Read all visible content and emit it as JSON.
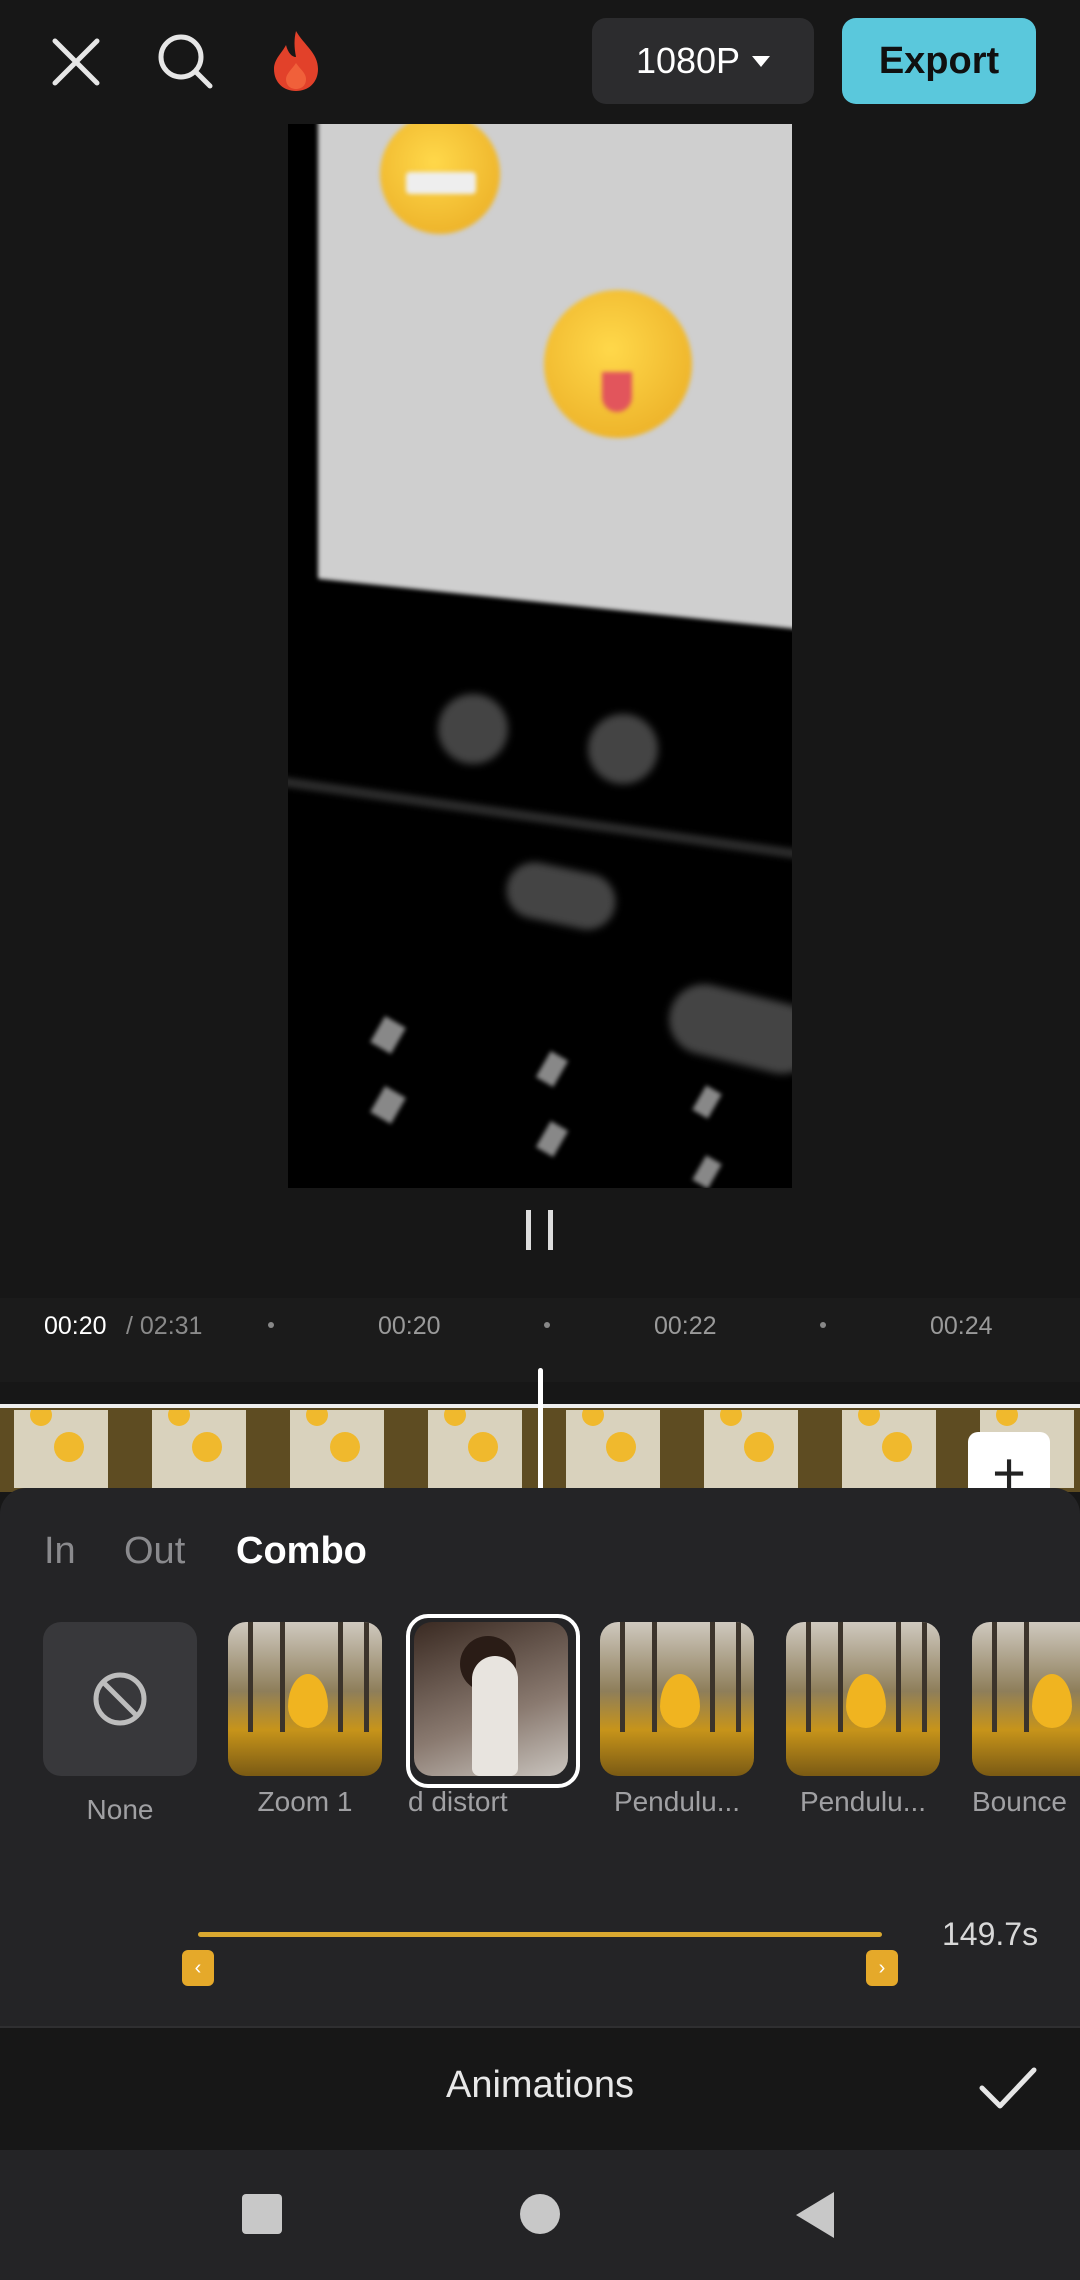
{
  "header": {
    "close_icon": "close-icon",
    "search_icon": "search-icon",
    "flame_icon": "flame-icon",
    "resolution_label": "1080P",
    "export_label": "Export",
    "export_color": "#5ac8dc"
  },
  "player": {
    "pause_icon": "pause-icon",
    "current_time": "00:20",
    "total_time": "/ 02:31"
  },
  "timeline": {
    "ticks": [
      "00:20",
      "00:22",
      "00:24"
    ],
    "add_clip_icon": "plus-icon"
  },
  "animation_panel": {
    "tabs": [
      "In",
      "Out",
      "Combo"
    ],
    "active_tab": "Combo",
    "items": [
      {
        "label": "None",
        "icon": "ban-icon"
      },
      {
        "label": "Zoom 1"
      },
      {
        "label": "d distort",
        "selected": true
      },
      {
        "label": "Pendulu..."
      },
      {
        "label": "Pendulu..."
      },
      {
        "label": "Bounce"
      }
    ],
    "duration": "149.7s",
    "accent_color": "#e5a92a",
    "title": "Animations",
    "confirm_icon": "check-icon"
  },
  "system_nav": {
    "recents_icon": "square-icon",
    "home_icon": "circle-icon",
    "back_icon": "triangle-back-icon"
  }
}
